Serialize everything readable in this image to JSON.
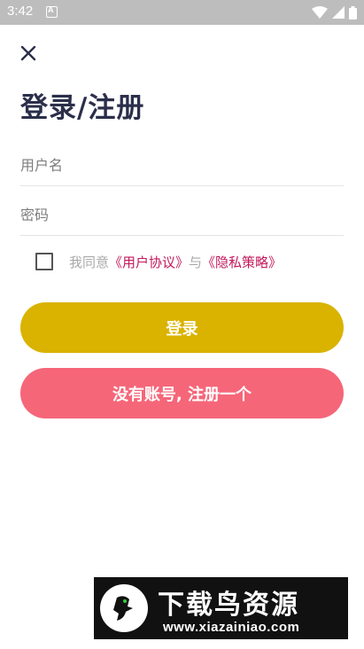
{
  "status_bar": {
    "time": "3:42",
    "notification_icon": "A"
  },
  "header": {
    "close_icon": "close-icon",
    "title": "登录/注册"
  },
  "form": {
    "username_placeholder": "用户名",
    "password_placeholder": "密码",
    "agree_prefix": "我同意",
    "user_agreement_link": "《用户协议》",
    "agree_joiner": "与",
    "privacy_policy_link": "《隐私策略》"
  },
  "buttons": {
    "login_label": "登录",
    "register_label": "没有账号, 注册一个"
  },
  "watermark": {
    "title": "下载鸟资源",
    "url": "www.xiazainiao.com"
  },
  "colors": {
    "title": "#2b2f4a",
    "login_button": "#d9b300",
    "register_button": "#f56679",
    "link": "#c2185b",
    "status_bar": "#bdbdbd"
  }
}
